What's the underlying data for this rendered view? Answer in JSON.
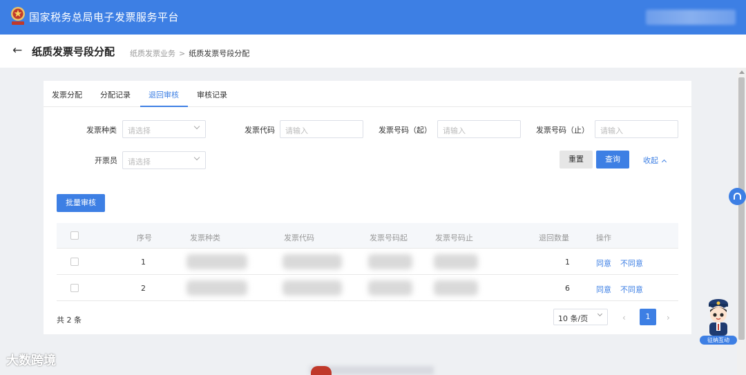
{
  "topbar": {
    "title": "国家税务总局电子发票服务平台"
  },
  "header": {
    "title": "纸质发票号段分配",
    "breadcrumb": {
      "parent": "纸质发票业务",
      "separator": ">",
      "current": "纸质发票号段分配"
    }
  },
  "tabs": [
    "发票分配",
    "分配记录",
    "退回审核",
    "审核记录"
  ],
  "active_tab": "退回审核",
  "form": {
    "invoice_type": {
      "label": "发票种类",
      "placeholder": "请选择"
    },
    "invoice_code": {
      "label": "发票代码",
      "placeholder": "请输入"
    },
    "number_start": {
      "label": "发票号码（起）",
      "placeholder": "请输入"
    },
    "number_end": {
      "label": "发票号码（止）",
      "placeholder": "请输入"
    },
    "issuer": {
      "label": "开票员",
      "placeholder": "请选择"
    },
    "reset": "重置",
    "query": "查询",
    "collapse": "收起"
  },
  "batch_button": "批量审核",
  "table": {
    "columns": [
      "序号",
      "发票种类",
      "发票代码",
      "发票号码起",
      "发票号码止",
      "退回数量",
      "操作"
    ],
    "rows": [
      {
        "index": "1",
        "return_qty": "1",
        "agree": "同意",
        "disagree": "不同意"
      },
      {
        "index": "2",
        "return_qty": "6",
        "agree": "同意",
        "disagree": "不同意"
      }
    ]
  },
  "pagination": {
    "total": "共 2 条",
    "page_size": "10 条/页",
    "prev": "‹",
    "next": "›",
    "current_page": "1"
  },
  "mascot_label": "征纳互动",
  "watermark": "大数跨境",
  "colors": {
    "primary": "#3d7fe4",
    "header_bg": "#3d7fe4",
    "page_bg": "#eef0f3"
  },
  "icons": [
    "tax-emblem-icon",
    "back-arrow-icon",
    "chevron-down-icon",
    "chevron-up-icon",
    "headset-icon"
  ]
}
